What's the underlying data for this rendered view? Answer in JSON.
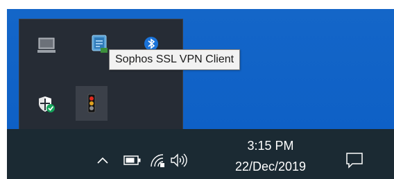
{
  "tray_overflow": {
    "icons": [
      {
        "name": "monitor-icon",
        "active": false
      },
      {
        "name": "sophos-vpn-connection-icon",
        "active": false
      },
      {
        "name": "bluetooth-icon",
        "active": false
      },
      {
        "name": "windows-defender-shield-icon",
        "active": false
      },
      {
        "name": "sophos-ssl-vpn-traffic-light-icon",
        "active": true
      }
    ]
  },
  "tooltip": {
    "text": "Sophos SSL VPN Client"
  },
  "taskbar": {
    "clock": {
      "time": "3:15 PM",
      "date": "22/Dec/2019"
    },
    "icons": [
      "chevron-up-icon",
      "battery-icon",
      "wifi-icon",
      "speaker-icon",
      "notification-icon"
    ]
  },
  "colors": {
    "wallpaper": "#1466c8",
    "flyout": "#262c35",
    "taskbar": "#1b2a33",
    "tooltip_bg": "#f2f2f2"
  }
}
